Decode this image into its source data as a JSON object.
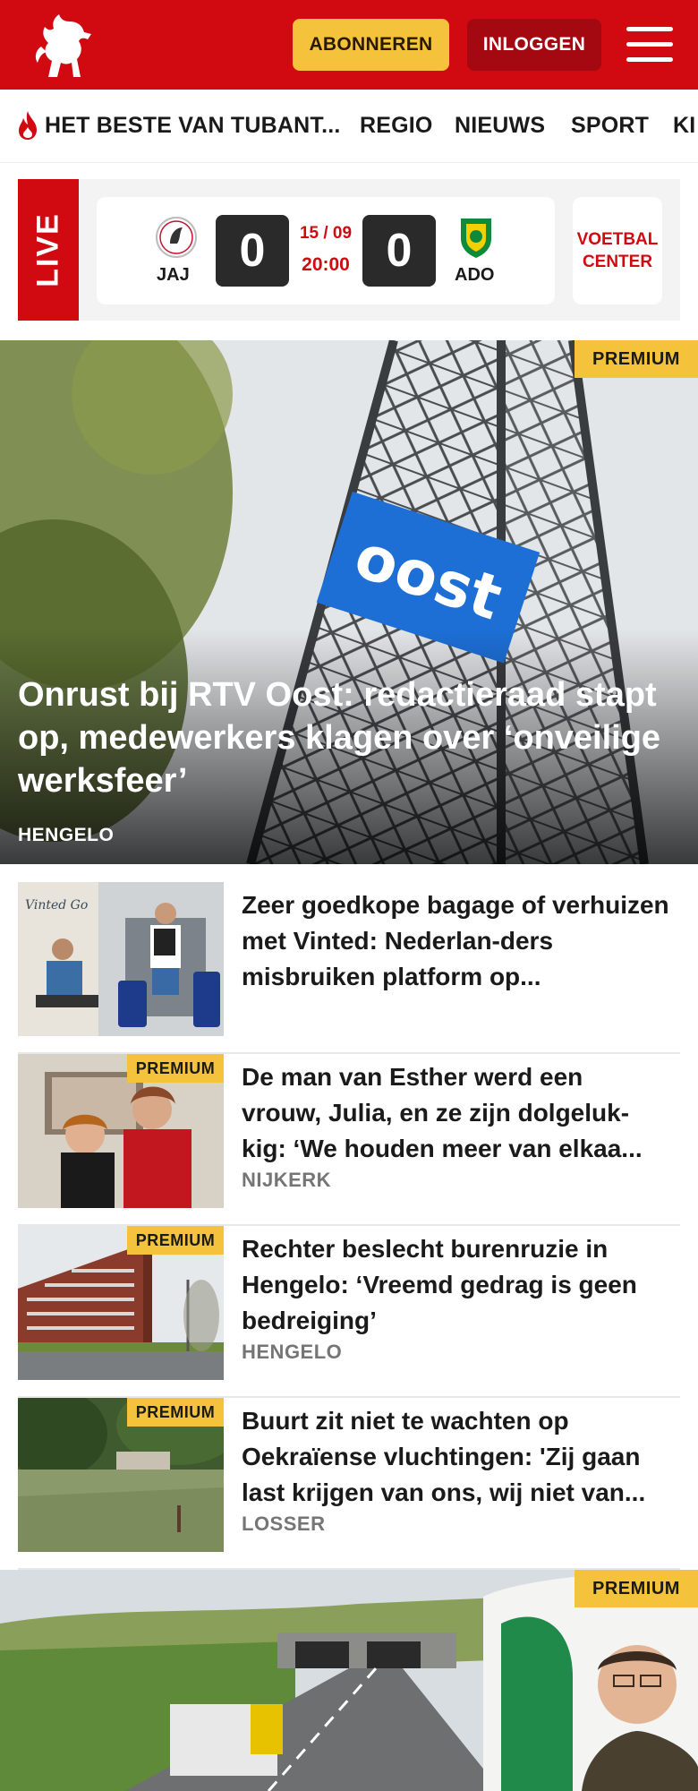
{
  "header": {
    "subscribe_label": "ABONNEREN",
    "login_label": "INLOGGEN",
    "brand_color": "#d10a11"
  },
  "nav": {
    "items": [
      {
        "label": "HET BESTE VAN TUBANT..."
      },
      {
        "label": "REGIO"
      },
      {
        "label": "NIEUWS"
      },
      {
        "label": "SPORT"
      },
      {
        "label": "KI"
      }
    ]
  },
  "live": {
    "tag": "LIVE",
    "home_team": "JAJ",
    "away_team": "ADO",
    "home_score": "0",
    "away_score": "0",
    "date": "15 / 09",
    "time": "20:00",
    "center_line1": "VOETBAL",
    "center_line2": "CENTER"
  },
  "hero": {
    "badge": "PREMIUM",
    "sign_text": "oost",
    "title": "Onrust bij RTV Oost: redactieraad stapt op, medewerkers klagen over ‘onveilige werksfeer’",
    "location": "HENGELO"
  },
  "articles": [
    {
      "thumb_text": "Vinted Go",
      "title": "Zeer goedkope bagage of verhuizen met Vinted: Nederlan-ders misbruiken platform op...",
      "location": "",
      "premium": false
    },
    {
      "badge": "PREMIUM",
      "title": "De man van Esther werd een vrouw, Julia, en ze zijn dolgeluk-kig: ‘We houden meer van elkaa...",
      "location": "NIJKERK",
      "premium": true
    },
    {
      "badge": "PREMIUM",
      "title": "Rechter beslecht burenruzie in Hengelo: ‘Vreemd gedrag is geen bedreiging’",
      "location": "HENGELO",
      "premium": true
    },
    {
      "badge": "PREMIUM",
      "title": "Buurt zit niet te wachten op Oekraïense vluchtingen: 'Zij gaan last krijgen van ons, wij niet van...",
      "location": "LOSSER",
      "premium": true
    }
  ],
  "hero2": {
    "badge": "PREMIUM"
  }
}
